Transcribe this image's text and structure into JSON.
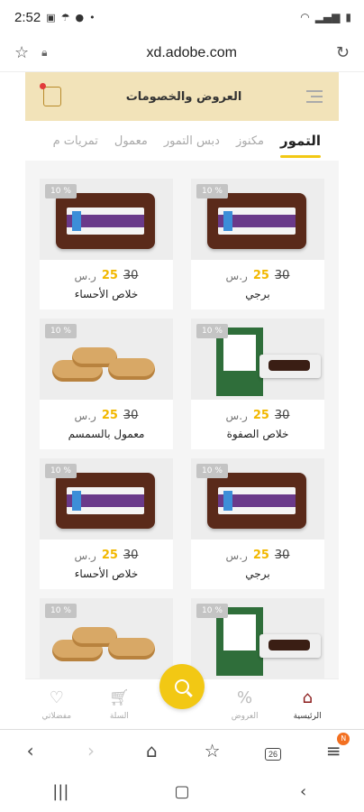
{
  "status": {
    "time": "2:52"
  },
  "browser": {
    "url": "xd.adobe.com",
    "tabs_count": "26",
    "notification": "N"
  },
  "header": {
    "title": "العروض والخصومات"
  },
  "tabs": [
    "التمور",
    "مكنوز",
    "دبس التمور",
    "معمول",
    "تمريات م"
  ],
  "products": [
    {
      "name": "برجي",
      "old_price": "30",
      "new_price": "25",
      "currency": "ر.س",
      "discount": "10 %",
      "image": "dates-pack"
    },
    {
      "name": "خلاص الأحساء",
      "old_price": "30",
      "new_price": "25",
      "currency": "ر.س",
      "discount": "10 %",
      "image": "dates-pack"
    },
    {
      "name": "خلاص الصفوة",
      "old_price": "30",
      "new_price": "25",
      "currency": "ر.س",
      "discount": "10 %",
      "image": "dates-box"
    },
    {
      "name": "معمول بالسمسم",
      "old_price": "30",
      "new_price": "25",
      "currency": "ر.س",
      "discount": "10 %",
      "image": "maamoul"
    },
    {
      "name": "برجي",
      "old_price": "30",
      "new_price": "25",
      "currency": "ر.س",
      "discount": "10 %",
      "image": "dates-pack"
    },
    {
      "name": "خلاص الأحساء",
      "old_price": "30",
      "new_price": "25",
      "currency": "ر.س",
      "discount": "10 %",
      "image": "dates-pack"
    },
    {
      "name": "",
      "old_price": "",
      "new_price": "",
      "currency": "",
      "discount": "10 %",
      "image": "dates-box"
    },
    {
      "name": "",
      "old_price": "",
      "new_price": "",
      "currency": "",
      "discount": "10 %",
      "image": "maamoul"
    }
  ],
  "bottom_nav": {
    "home": "الرئيسية",
    "offers": "العروض",
    "cart": "السلة",
    "favorites": "مفضلاتي"
  },
  "colors": {
    "accent": "#f2c814",
    "header_bg": "#f2e3b9",
    "price_new": "#f2b800"
  }
}
